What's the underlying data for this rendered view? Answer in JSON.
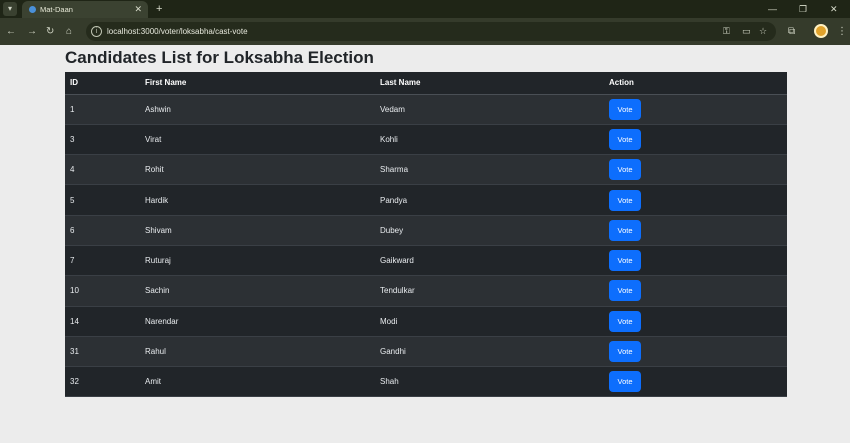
{
  "browser": {
    "tab_title": "Mat-Daan",
    "tab_close": "✕",
    "new_tab": "+",
    "url": "localhost:3000/voter/loksabha/cast-vote",
    "window_controls": [
      "—",
      "❐",
      "✕"
    ]
  },
  "page": {
    "title": "Candidates List for Loksabha Election",
    "columns": [
      "ID",
      "First Name",
      "Last Name",
      "Action"
    ],
    "vote_label": "Vote",
    "rows": [
      {
        "id": "1",
        "first": "Ashwin",
        "last": "Vedam"
      },
      {
        "id": "3",
        "first": "Virat",
        "last": "Kohli"
      },
      {
        "id": "4",
        "first": "Rohit",
        "last": "Sharma"
      },
      {
        "id": "5",
        "first": "Hardik",
        "last": "Pandya"
      },
      {
        "id": "6",
        "first": "Shivam",
        "last": "Dubey"
      },
      {
        "id": "7",
        "first": "Ruturaj",
        "last": "Gaikward"
      },
      {
        "id": "10",
        "first": "Sachin",
        "last": "Tendulkar"
      },
      {
        "id": "14",
        "first": "Narendar",
        "last": "Modi"
      },
      {
        "id": "31",
        "first": "Rahul",
        "last": "Gandhi"
      },
      {
        "id": "32",
        "first": "Amit",
        "last": "Shah"
      }
    ]
  },
  "colors": {
    "table_dark": "#212529",
    "table_stripe": "#2c3034",
    "button_primary": "#0d6efd",
    "page_background": "#ececec"
  },
  "icons": [
    "tab-search-icon",
    "favicon-icon",
    "back-icon",
    "forward-icon",
    "reload-icon",
    "home-icon",
    "site-info-icon",
    "password-key-icon",
    "cast-icon",
    "bookmark-star-icon",
    "extensions-icon",
    "profile-avatar-icon",
    "menu-dots-icon"
  ]
}
